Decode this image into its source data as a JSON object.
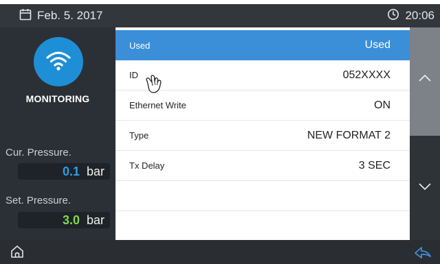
{
  "header": {
    "date": "Feb. 5. 2017",
    "time": "20:06"
  },
  "left_panel": {
    "mode_label": "MONITORING",
    "cur_pressure_label": "Cur. Pressure.",
    "cur_pressure_value": "0.1",
    "cur_pressure_unit": "bar",
    "set_pressure_label": "Set. Pressure.",
    "set_pressure_value": "3.0",
    "set_pressure_unit": "bar"
  },
  "list": {
    "rows": [
      {
        "label": "Used",
        "value": "Used"
      },
      {
        "label": "ID",
        "value": "052XXXX"
      },
      {
        "label": "Ethernet Write",
        "value": "ON"
      },
      {
        "label": "Type",
        "value": "NEW FORMAT 2"
      },
      {
        "label": "Tx Delay",
        "value": "3 SEC"
      },
      {
        "label": "",
        "value": ""
      },
      {
        "label": "",
        "value": ""
      }
    ]
  },
  "colors": {
    "accent_blue": "#3b8fd9",
    "wifi_blue": "#1e8fd6",
    "cur_value": "#2f9ee8",
    "set_value": "#7fd94e",
    "back_icon": "#3b8fd9"
  },
  "icons": {
    "date": "calendar-icon",
    "time": "clock-icon",
    "status": "wifi-icon",
    "home": "home-icon",
    "back": "back-arrow-icon",
    "scroll_up": "chevron-up-icon",
    "scroll_down": "chevron-down-icon",
    "cursor": "hand-cursor-icon"
  }
}
